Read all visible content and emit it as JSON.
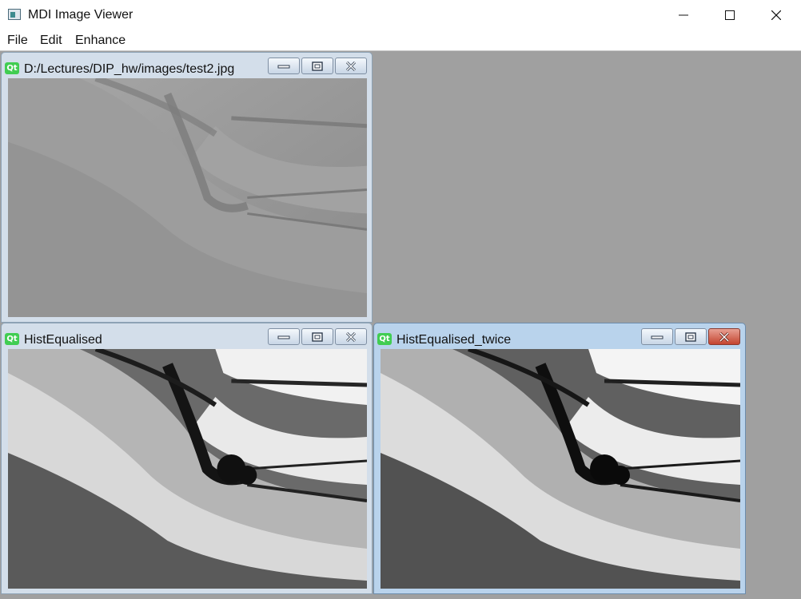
{
  "app": {
    "title": "MDI Image Viewer",
    "icon": "app-window-icon"
  },
  "window_controls": [
    "minimize-icon",
    "maximize-icon",
    "close-icon"
  ],
  "menu": {
    "items": [
      "File",
      "Edit",
      "Enhance"
    ]
  },
  "subwindows": [
    {
      "title": "D:/Lectures/DIP_hw/images/test2.jpg",
      "icon": "qt-icon",
      "icon_text": "Qt",
      "image": "low-contrast grayscale hillside photo"
    },
    {
      "title": "HistEqualised",
      "icon": "qt-icon",
      "icon_text": "Qt",
      "image": "histogram-equalised grayscale hillside photo"
    },
    {
      "title": "HistEqualised_twice",
      "icon": "qt-icon",
      "icon_text": "Qt",
      "image": "histogram-equalised twice grayscale hillside photo",
      "active": true
    }
  ],
  "colors": {
    "mdi_background": "#a0a0a0",
    "active_frame": "#b9d3ec",
    "inactive_frame": "#d3deea",
    "active_close": "#c4442f",
    "qt_green": "#41cd52"
  }
}
